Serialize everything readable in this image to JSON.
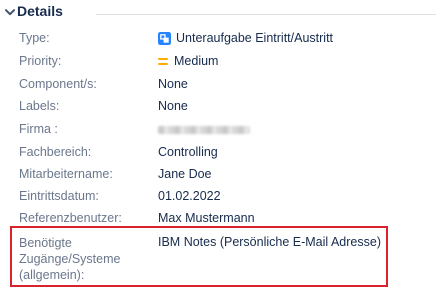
{
  "section": {
    "title": "Details",
    "toggle_icon": "chevron-down-icon"
  },
  "fields": {
    "type": {
      "label": "Type:",
      "value": "Unteraufgabe Eintritt/Austritt",
      "icon": "subtask-icon",
      "icon_color": "#2684ff"
    },
    "priority": {
      "label": "Priority:",
      "value": "Medium",
      "icon": "priority-medium-icon",
      "icon_color": "#ffab00"
    },
    "components": {
      "label": "Component/s:",
      "value": "None"
    },
    "labels": {
      "label": "Labels:",
      "value": "None"
    },
    "firma": {
      "label": "Firma :"
    },
    "fachbereich": {
      "label": "Fachbereich:",
      "value": "Controlling"
    },
    "mitarbeitername": {
      "label": "Mitarbeitername:",
      "value": "Jane Doe"
    },
    "eintrittsdatum": {
      "label": "Eintrittsdatum:",
      "value": "01.02.2022"
    },
    "referenzbenutzer": {
      "label": "Referenzbenutzer:",
      "value": "Max Mustermann"
    },
    "zugaenge": {
      "label_lines": [
        "Benötigte",
        "Zugänge/Systeme",
        "(allgemein):"
      ],
      "value": "IBM Notes (Persönliche E-Mail Adresse)"
    }
  },
  "colors": {
    "label": "#6b778c",
    "value": "#172b4d",
    "highlight": "#d9232c"
  }
}
